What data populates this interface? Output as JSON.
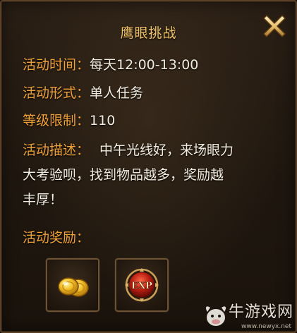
{
  "dialog": {
    "title": "鹰眼挑战",
    "close_icon": "close-x-icon"
  },
  "info": {
    "time_label": "活动时间：",
    "time_value": "每天12:00-13:00",
    "form_label": "活动形式：",
    "form_value": "单人任务",
    "level_label": "等级限制：",
    "level_value": "110",
    "desc_label": "活动描述：",
    "desc_line1": "中午光线好，来场眼力",
    "desc_line2": "大考验呗，找到物品越多，奖励越",
    "desc_line3": "丰厚！"
  },
  "rewards": {
    "title": "活动奖励：",
    "items": [
      {
        "icon": "gold-coins-icon"
      },
      {
        "icon": "exp-orb-icon",
        "text": "EXP"
      }
    ]
  },
  "watermark": {
    "brand": "牛游戏网",
    "url": "www.newyx.net",
    "icon": "bull-logo-icon"
  },
  "colors": {
    "title": "#f3c56a",
    "label": "#f0a23a",
    "value": "#f1ece0",
    "panel_bg": "#1f170f"
  }
}
